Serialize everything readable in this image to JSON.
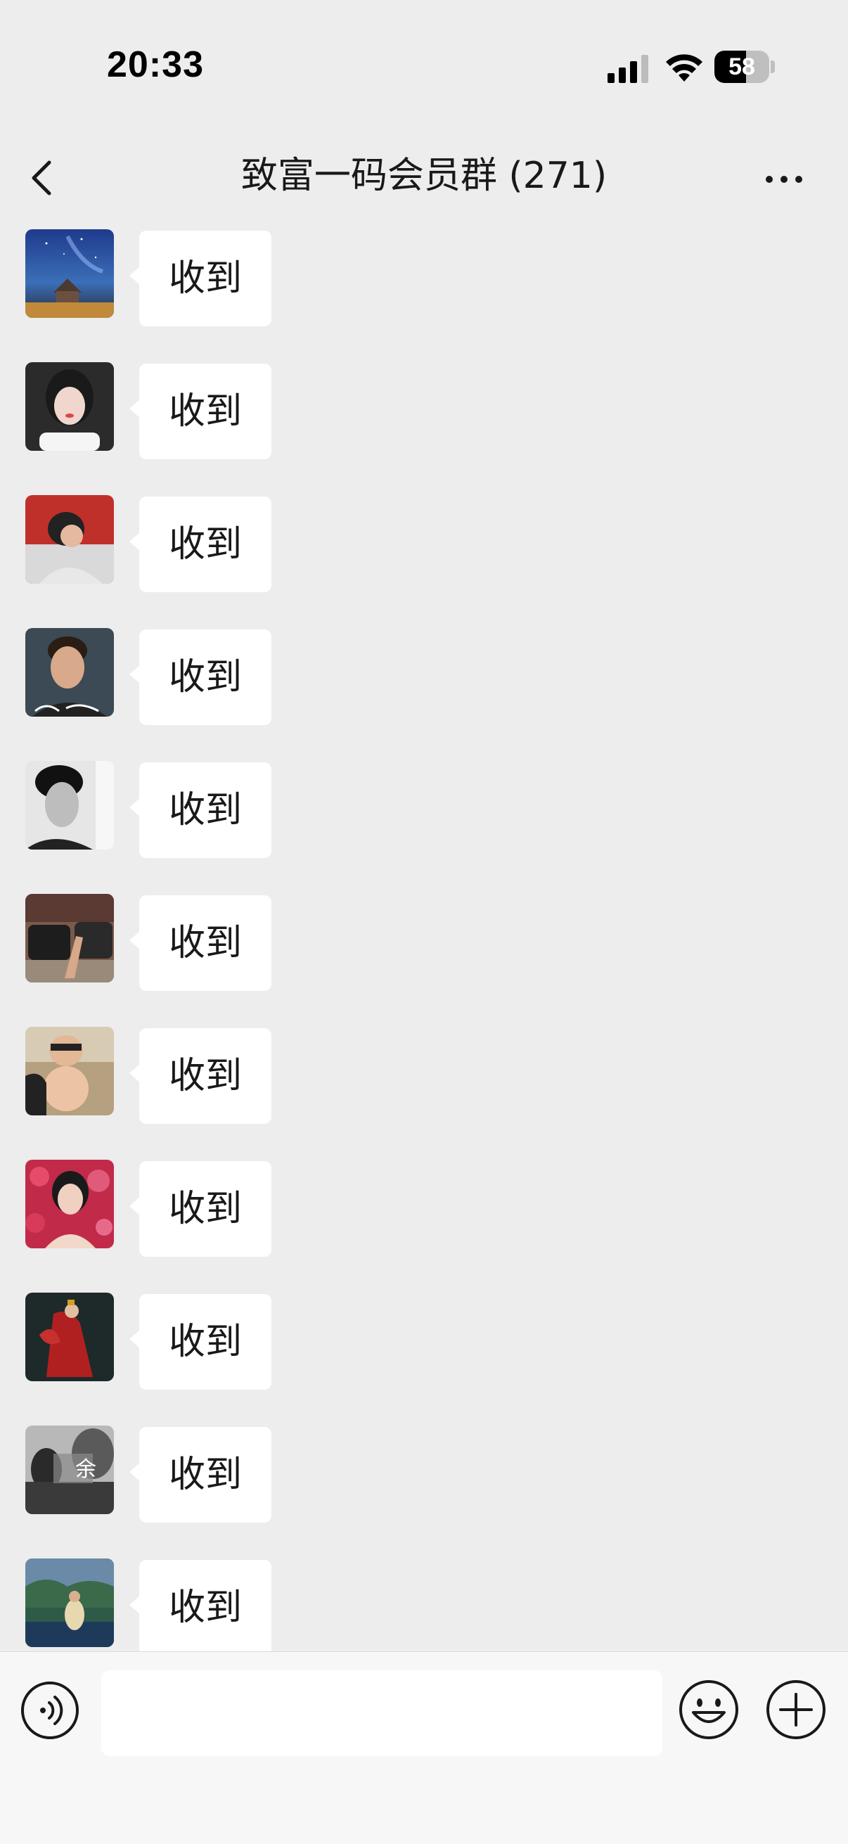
{
  "status_bar": {
    "time": "20:33",
    "battery_percent": "58",
    "battery_level": 0.58
  },
  "nav": {
    "title": "致富一码会员群 (271)"
  },
  "messages": [
    {
      "text": "收到",
      "avatar": "starry-night-cabin"
    },
    {
      "text": "收到",
      "avatar": "woman-selfie-car"
    },
    {
      "text": "收到",
      "avatar": "man-red-background"
    },
    {
      "text": "收到",
      "avatar": "man-portrait-signature"
    },
    {
      "text": "收到",
      "avatar": "black-white-portrait"
    },
    {
      "text": "收到",
      "avatar": "couple-hands-car"
    },
    {
      "text": "收到",
      "avatar": "father-child-selfie"
    },
    {
      "text": "收到",
      "avatar": "woman-red-flowers"
    },
    {
      "text": "收到",
      "avatar": "red-costume-dancer"
    },
    {
      "text": "收到",
      "avatar": "grey-portrait-text"
    },
    {
      "text": "收到",
      "avatar": "lake-landscape-person"
    }
  ],
  "avatar_overlay_text": "余",
  "colors": {
    "background": "#EDEDED",
    "bubble": "#FFFFFF",
    "input_bar": "#F7F7F7",
    "text": "#191919"
  }
}
